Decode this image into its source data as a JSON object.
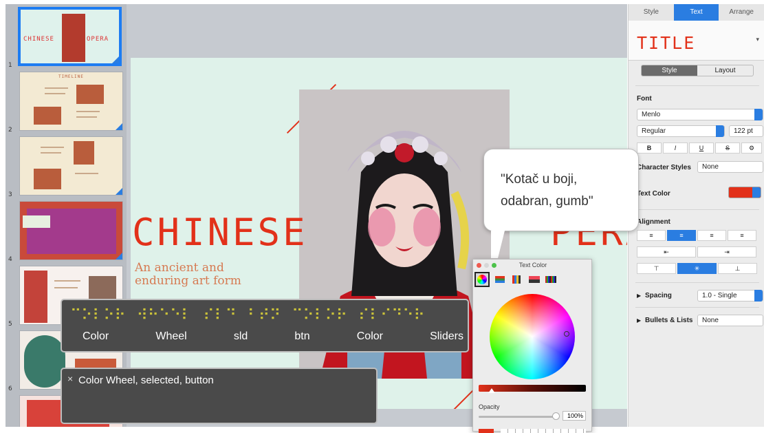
{
  "thumbnails": {
    "numbers": [
      "1",
      "2",
      "3",
      "4",
      "5",
      "6"
    ],
    "slide1_title_left": "CHINESE",
    "slide1_title_right": "OPERA",
    "slide2_heading": "TIMELINE"
  },
  "slide": {
    "title_left": "CHINESE",
    "title_right": "PERA",
    "subtitle_line1": "An ancient and",
    "subtitle_line2": "enduring art form"
  },
  "inspector": {
    "tabs": [
      "Style",
      "Text",
      "Arrange"
    ],
    "paragraph_style": "TITLE",
    "segment": [
      "Style",
      "Layout"
    ],
    "font_label": "Font",
    "font_name": "Menlo",
    "font_weight": "Regular",
    "font_size": "122 pt",
    "format_buttons": [
      "B",
      "I",
      "U",
      "S"
    ],
    "gear_label": "⚙︎",
    "character_styles_label": "Character Styles",
    "character_styles_value": "None",
    "text_color_label": "Text Color",
    "alignment_label": "Alignment",
    "spacing_label": "Spacing",
    "spacing_value": "1.0 - Single",
    "bullets_label": "Bullets & Lists",
    "bullets_value": "None"
  },
  "bubble": {
    "line1": "\"Kotač u boji,",
    "line2": "odabran, gumb\""
  },
  "color_panel": {
    "title": "Text Color",
    "opacity_label": "Opacity",
    "opacity_value": "100%"
  },
  "braille": {
    "cells": "⠉⠕⠇⠕⠗⠀⠺⠓⠑⠑⠇⠀⠎⠇⠙⠀⠃⠞⠝⠀⠉⠕⠇⠕⠗⠀⠎⠇⠊⠙⠑⠗",
    "words": [
      "Color",
      "Wheel",
      "sld",
      "btn",
      "Color",
      "Sliders"
    ]
  },
  "caption": {
    "close": "×",
    "text": "Color Wheel, selected, button"
  },
  "colors": {
    "accent": "#2a7de1",
    "title_red": "#e2311a",
    "slide_bg": "#dff2ea"
  }
}
